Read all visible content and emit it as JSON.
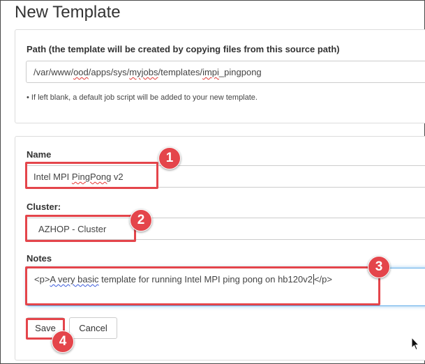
{
  "page": {
    "title": "New Template"
  },
  "path_section": {
    "label": "Path (the template will be created by copying files from this source path)",
    "value_parts": [
      "/var/www/",
      "ood",
      "/apps/sys/",
      "myjobs",
      "/templates/",
      "impi",
      "_pingpong"
    ],
    "hint": "• If left blank, a default job script will be added to your new template."
  },
  "form": {
    "name_label": "Name",
    "name_parts": [
      "Intel MPI ",
      "PingPong",
      " v2"
    ],
    "cluster_label": "Cluster:",
    "cluster_value": "AZHOP - Cluster",
    "notes_label": "Notes",
    "notes_parts": [
      "<p>",
      "A very basic",
      " template for running Intel MPI ping pong on hb120v2",
      "</p>"
    ]
  },
  "buttons": {
    "save": "Save",
    "cancel": "Cancel"
  },
  "callouts": [
    "1",
    "2",
    "3",
    "4"
  ],
  "colors": {
    "callout": "#e4454b",
    "focus_border": "#66afe9"
  },
  "icons": {
    "cursor": "mouse-pointer-icon"
  }
}
